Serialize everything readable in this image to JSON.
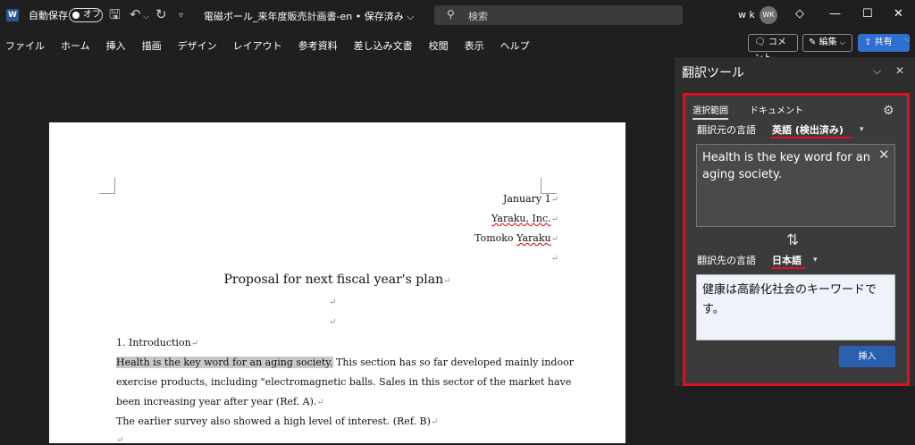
{
  "titlebar": {
    "app_logo": "W",
    "autosave_label": "自動保存",
    "autosave_state": "オフ",
    "document_title": "電磁ボール_来年度販売計画書-en • 保存済み ⌵",
    "search_placeholder": "検索",
    "user_name": "w k",
    "user_initials": "WK"
  },
  "ribbon": {
    "tabs": [
      "ファイル",
      "ホーム",
      "挿入",
      "描画",
      "デザイン",
      "レイアウト",
      "参考資料",
      "差し込み文書",
      "校閲",
      "表示",
      "ヘルプ"
    ],
    "comment_button": "コメント",
    "edit_button": "編集",
    "share_button": "共有"
  },
  "document": {
    "date": "January 1",
    "company": "Yaraku, Inc.",
    "author_first": "Tomoko ",
    "author_last": "Yaraku",
    "title": "Proposal for next fiscal year's plan",
    "pilcrow": "↵",
    "heading1": "1. Introduction",
    "highlighted_sentence": "Health is the key word for an aging society.",
    "line1_rest": " This section has so far developed mainly indoor",
    "line2": "exercise products, including \"electromagnetic balls. Sales in this sector of the market have",
    "line3": "been increasing year after year (Ref. A).",
    "line4": "The earlier survey also showed a high level of interest. (Ref. B)"
  },
  "panel": {
    "title": "翻訳ツール",
    "tab_selection": "選択範囲",
    "tab_document": "ドキュメント",
    "source_label": "翻訳元の言語",
    "source_language": "英語 (検出済み)",
    "source_text": "Health is the key word for an aging society.",
    "target_label": "翻訳先の言語",
    "target_language": "日本語",
    "translated_text": "健康は高齢化社会のキーワードです。",
    "insert_button": "挿入"
  },
  "colors": {
    "highlight_frame": "#e01020",
    "share_button": "#2f6fd1",
    "insert_button": "#2b5fb0"
  }
}
